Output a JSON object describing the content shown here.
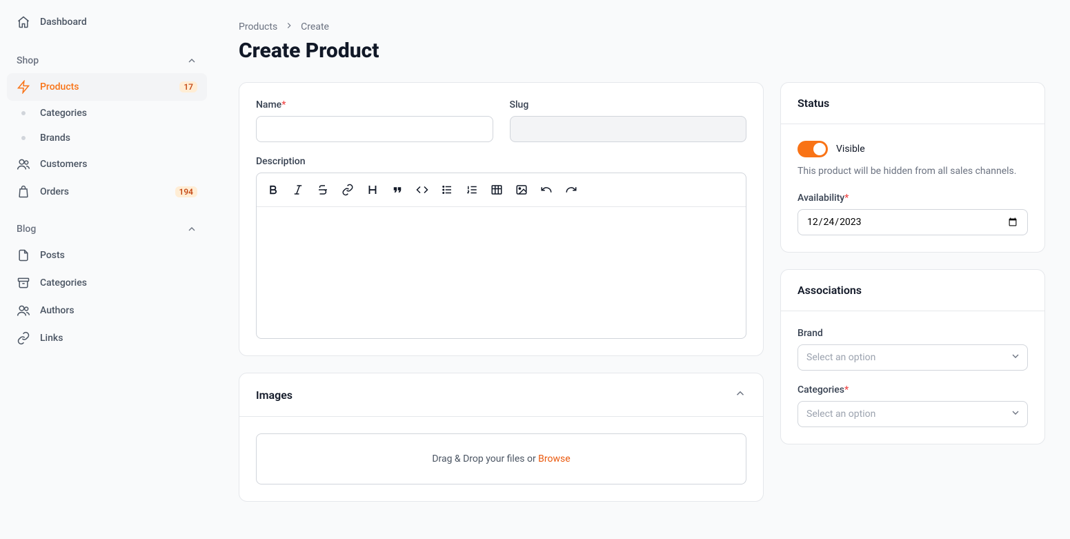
{
  "sidebar": {
    "dashboard": "Dashboard",
    "shop": {
      "label": "Shop",
      "products": {
        "label": "Products",
        "badge": "17"
      },
      "categories": "Categories",
      "brands": "Brands",
      "customers": "Customers",
      "orders": {
        "label": "Orders",
        "badge": "194"
      }
    },
    "blog": {
      "label": "Blog",
      "posts": "Posts",
      "categories": "Categories",
      "authors": "Authors",
      "links": "Links"
    }
  },
  "breadcrumb": {
    "products": "Products",
    "create": "Create"
  },
  "page_title": "Create Product",
  "form": {
    "name_label": "Name",
    "slug_label": "Slug",
    "description_label": "Description",
    "name_value": "",
    "slug_value": ""
  },
  "images": {
    "header": "Images",
    "dropzone_text": "Drag & Drop your files or ",
    "browse": "Browse"
  },
  "status": {
    "header": "Status",
    "visible_label": "Visible",
    "help": "This product will be hidden from all sales channels.",
    "availability_label": "Availability",
    "availability_value": "2023-12-24",
    "availability_display": "24/12/2023"
  },
  "associations": {
    "header": "Associations",
    "brand_label": "Brand",
    "categories_label": "Categories",
    "select_placeholder": "Select an option"
  }
}
